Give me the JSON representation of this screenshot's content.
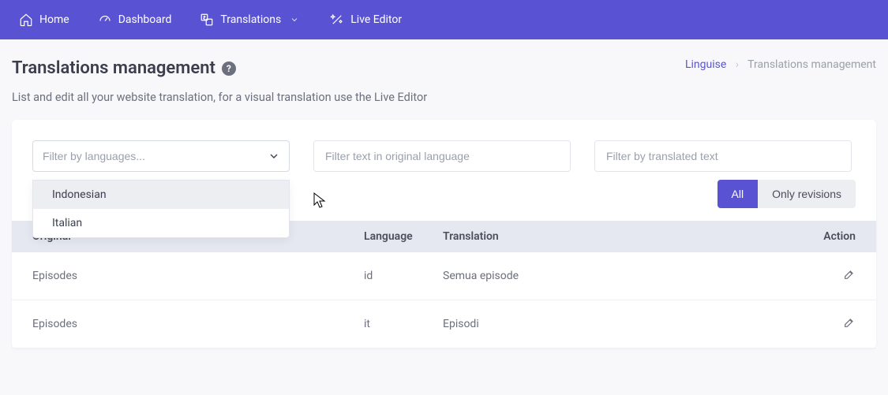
{
  "nav": {
    "home": "Home",
    "dashboard": "Dashboard",
    "translations": "Translations",
    "live_editor": "Live Editor"
  },
  "page": {
    "title": "Translations management",
    "description": "List and edit all your website translation, for a visual translation use the Live Editor"
  },
  "breadcrumb": {
    "root": "Linguise",
    "current": "Translations management"
  },
  "filters": {
    "lang_placeholder": "Filter by languages...",
    "orig_placeholder": "Filter text in original language",
    "trans_placeholder": "Filter by translated text",
    "options": [
      "Indonesian",
      "Italian"
    ]
  },
  "toggle": {
    "all": "All",
    "revisions": "Only revisions"
  },
  "table": {
    "headers": {
      "original": "Original",
      "language": "Language",
      "translation": "Translation",
      "action": "Action"
    },
    "rows": [
      {
        "original": "Episodes",
        "language": "id",
        "translation": "Semua episode"
      },
      {
        "original": "Episodes",
        "language": "it",
        "translation": "Episodi"
      }
    ]
  }
}
